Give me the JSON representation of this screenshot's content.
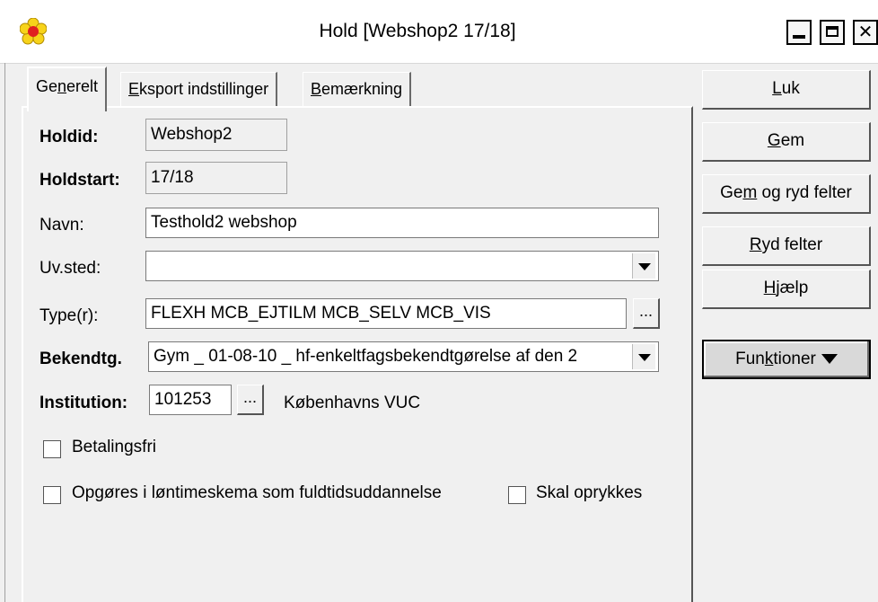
{
  "window": {
    "title": "Hold [Webshop2 17/18]"
  },
  "tabs": [
    {
      "pre": "Ge",
      "key": "n",
      "post": "erelt"
    },
    {
      "pre": "",
      "key": "E",
      "post": "ksport indstillinger"
    },
    {
      "pre": "",
      "key": "B",
      "post": "emærkning"
    }
  ],
  "form": {
    "holdid_label": "Holdid:",
    "holdid_value": "Webshop2",
    "holdstart_label": "Holdstart:",
    "holdstart_value": "17/18",
    "navn_label": "Navn:",
    "navn_value": "Testhold2 webshop",
    "uvsted_label": "Uv.sted:",
    "uvsted_value": "",
    "type_label": "Type(r):",
    "type_value": "FLEXH MCB_EJTILM MCB_SELV MCB_VIS",
    "type_button": "...",
    "bekendtg_label": "Bekendtg.",
    "bekendtg_value": "Gym _ 01-08-10 _ hf-enkeltfagsbekendtgørelse af den 2",
    "institution_label": "Institution:",
    "institution_value": "101253",
    "institution_button": "...",
    "institution_name": "Københavns VUC",
    "betalingsfri_label": "Betalingsfri",
    "betalingsfri_checked": false,
    "opgoeres_label": "Opgøres i løntimeskema som fuldtidsuddannelse",
    "opgoeres_checked": false,
    "oprykkes_label": "Skal oprykkes",
    "oprykkes_checked": false
  },
  "buttons": {
    "luk": {
      "pre": "",
      "key": "L",
      "post": "uk"
    },
    "gem": {
      "pre": "",
      "key": "G",
      "post": "em"
    },
    "gem_ryd": {
      "pre": "Ge",
      "key": "m",
      "post": " og ryd felter"
    },
    "ryd": {
      "pre": "",
      "key": "R",
      "post": "yd felter"
    },
    "hjaelp": {
      "pre": "",
      "key": "H",
      "post": "jælp"
    },
    "funktioner": {
      "pre": "Fun",
      "key": "k",
      "post": "tioner"
    }
  },
  "icons": {
    "app": "flower-icon",
    "minimize": "minimize-icon",
    "maximize": "maximize-icon",
    "close": "close-icon"
  },
  "colors": {
    "background": "#f0f0f0",
    "flower_petal": "#f7d31a",
    "flower_center": "#e02020"
  }
}
